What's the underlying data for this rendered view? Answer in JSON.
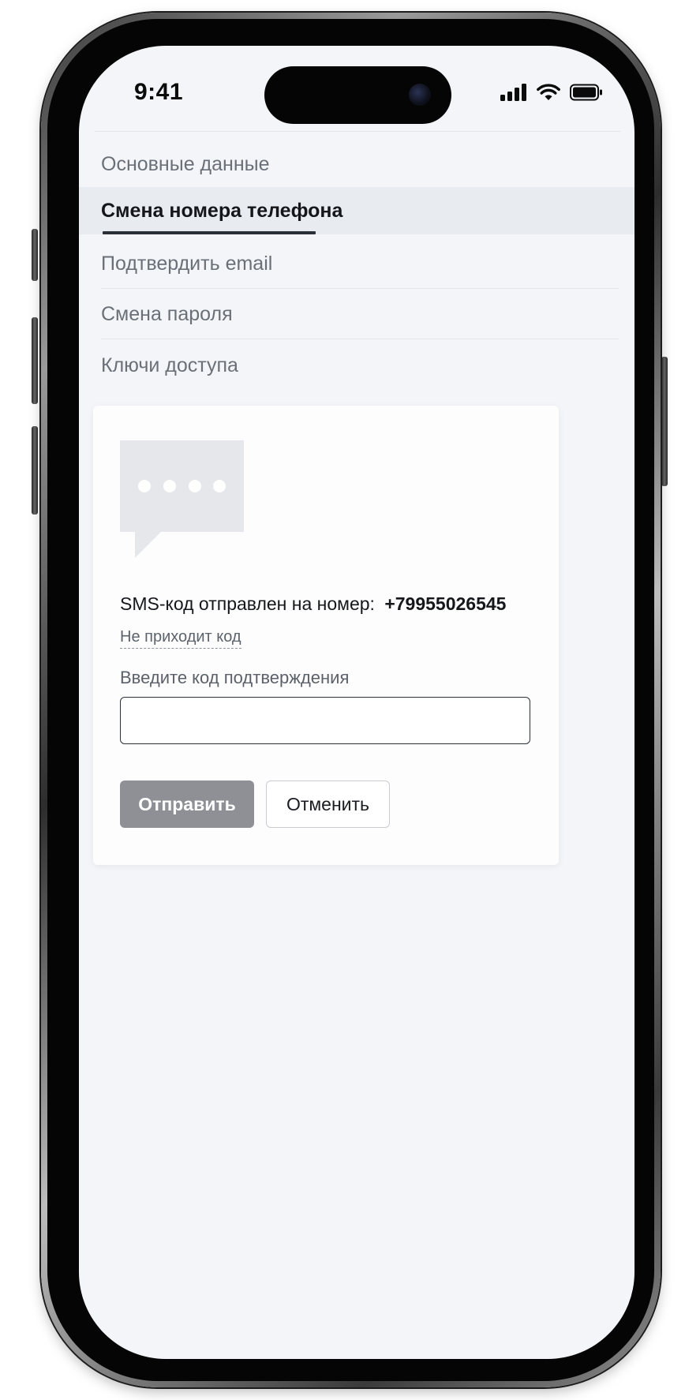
{
  "status_bar": {
    "time": "9:41",
    "icons": [
      "signal-icon",
      "wifi-icon",
      "battery-icon"
    ]
  },
  "menu": {
    "items": [
      {
        "label": "Основные данные",
        "active": false
      },
      {
        "label": "Смена номера телефона",
        "active": true
      },
      {
        "label": "Подтвердить email",
        "active": false
      },
      {
        "label": "Смена пароля",
        "active": false
      },
      {
        "label": "Ключи доступа",
        "active": false
      }
    ]
  },
  "card": {
    "illustration": "sms-bubble-icon",
    "sms_text": "SMS-код отправлен на номер:",
    "phone_number": "+79955026545",
    "no_code_link": "Не приходит код",
    "code_label": "Введите код подтверждения",
    "code_value": "",
    "send_button": "Отправить",
    "cancel_button": "Отменить"
  },
  "colors": {
    "screen_bg": "#f3f5f8",
    "active_tab_bg": "#e8ebef",
    "active_underline": "#2b3038",
    "send_button_bg": "#8e9096",
    "muted_text": "#6b7078"
  }
}
